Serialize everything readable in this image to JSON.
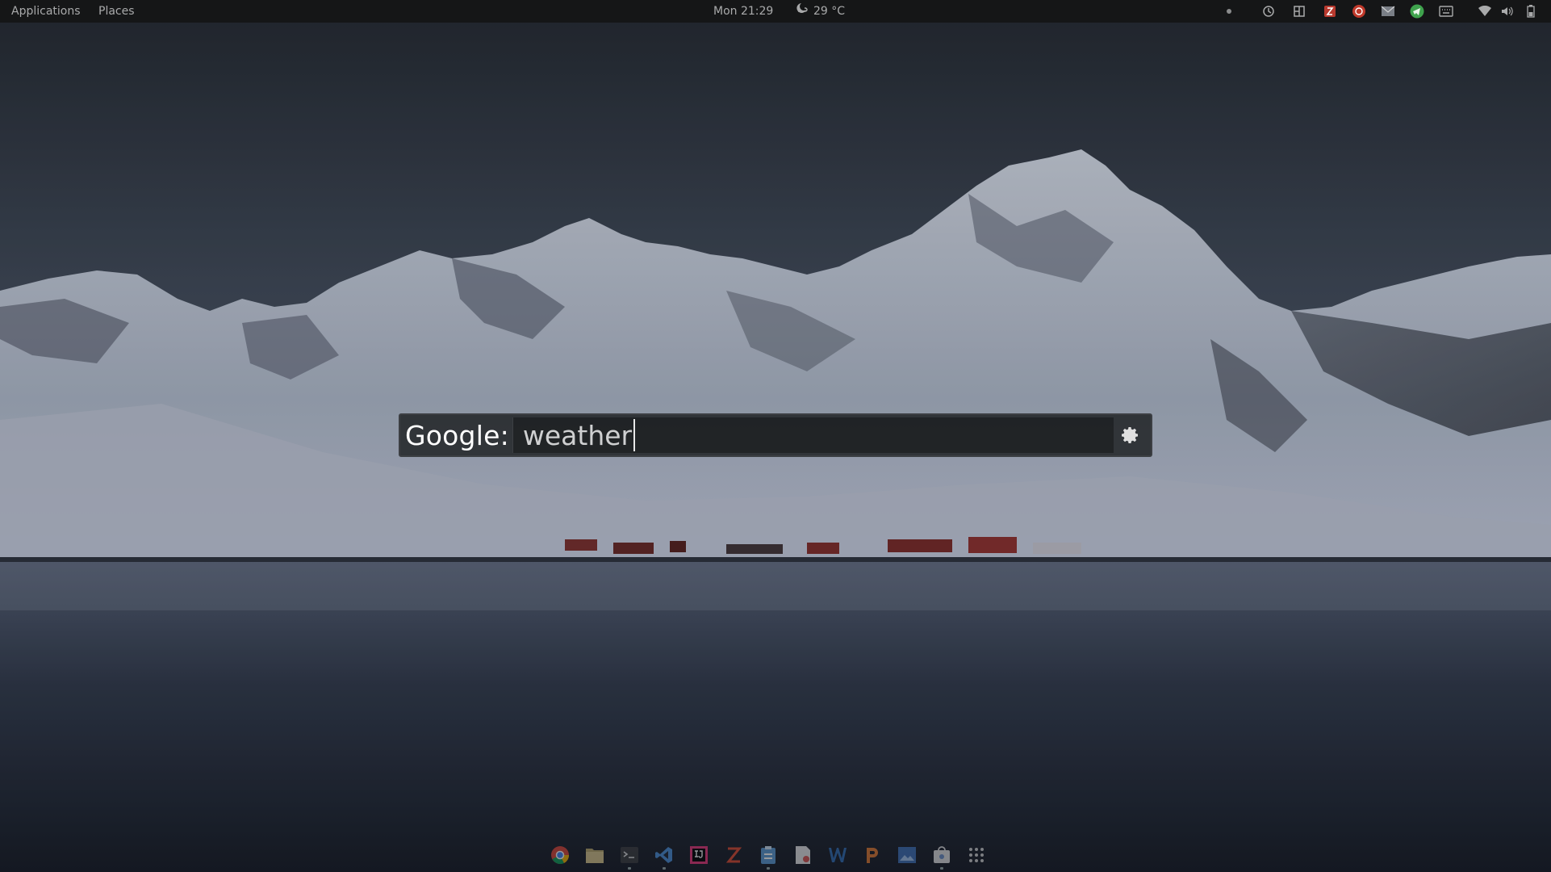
{
  "topbar": {
    "applications_label": "Applications",
    "places_label": "Places",
    "clock": "Mon 21:29",
    "weather_temp": "29 °C"
  },
  "launcher": {
    "engine_label": "Google:",
    "query": "weather"
  },
  "dock": {
    "items": [
      "chrome-icon",
      "files-icon",
      "terminal-icon",
      "vscode-icon",
      "intellij-icon",
      "zeal-icon",
      "clipboard-icon",
      "document-viewer-icon",
      "word-icon",
      "powerpoint-icon",
      "image-viewer-icon",
      "software-center-icon",
      "app-grid-icon"
    ]
  },
  "colors": {
    "topbar_bg": "#151617",
    "topbar_text": "#a9aaab",
    "search_label": "#ffffff",
    "search_text": "#cfd0d1"
  }
}
